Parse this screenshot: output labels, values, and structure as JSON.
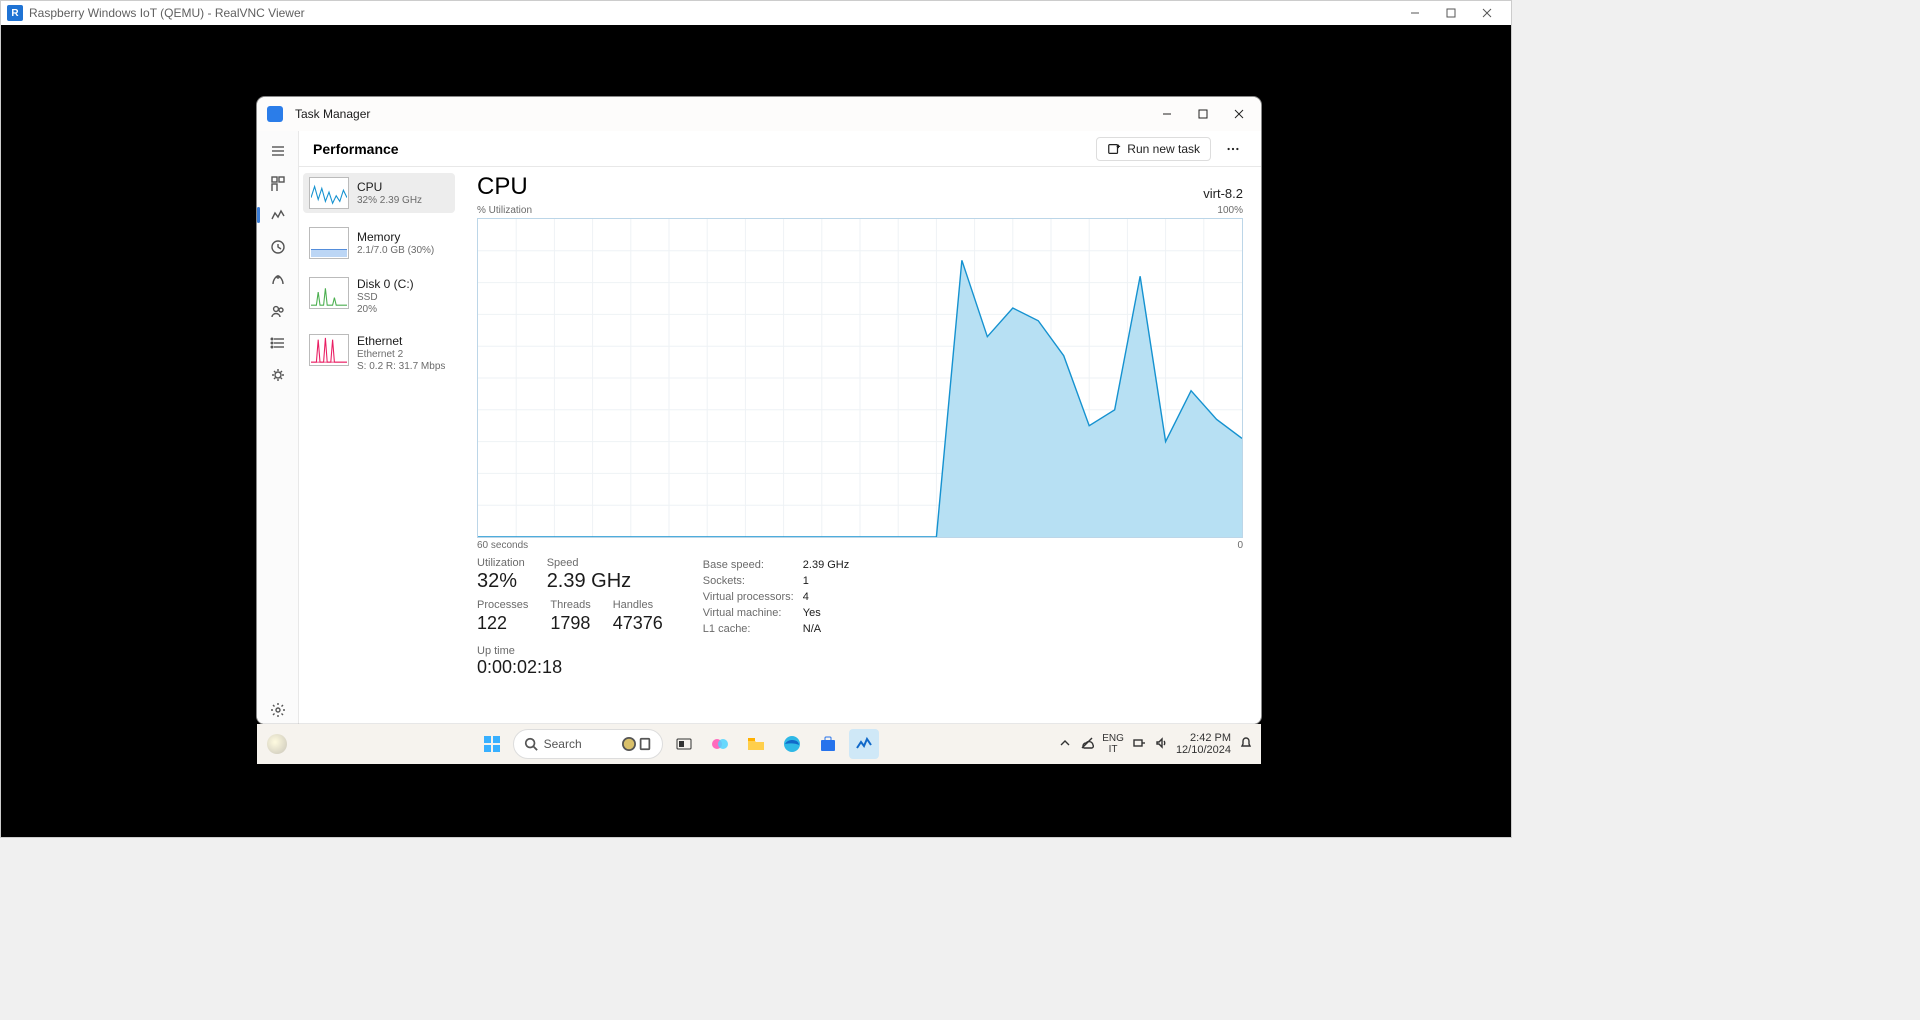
{
  "outer": {
    "title": "Raspberry Windows IoT (QEMU) - RealVNC Viewer"
  },
  "app": {
    "title": "Task Manager",
    "section": "Performance",
    "run_new_task": "Run new task"
  },
  "sidebar": {
    "items": [
      {
        "title": "CPU",
        "sub1": "32%  2.39 GHz"
      },
      {
        "title": "Memory",
        "sub1": "2.1/7.0 GB (30%)"
      },
      {
        "title": "Disk 0 (C:)",
        "sub1": "SSD",
        "sub2": "20%"
      },
      {
        "title": "Ethernet",
        "sub1": "Ethernet 2",
        "sub2": "S: 0.2 R: 31.7 Mbps"
      }
    ]
  },
  "cpu": {
    "name": "CPU",
    "model": "virt-8.2",
    "ylabel": "% Utilization",
    "ymax": "100%",
    "xlabel_left": "60 seconds",
    "xlabel_right": "0",
    "stats": {
      "utilization_label": "Utilization",
      "utilization_value": "32%",
      "speed_label": "Speed",
      "speed_value": "2.39 GHz",
      "processes_label": "Processes",
      "processes_value": "122",
      "threads_label": "Threads",
      "threads_value": "1798",
      "handles_label": "Handles",
      "handles_value": "47376",
      "uptime_label": "Up time",
      "uptime_value": "0:00:02:18"
    },
    "properties": [
      {
        "k": "Base speed:",
        "v": "2.39 GHz"
      },
      {
        "k": "Sockets:",
        "v": "1"
      },
      {
        "k": "Virtual processors:",
        "v": "4"
      },
      {
        "k": "Virtual machine:",
        "v": "Yes"
      },
      {
        "k": "L1 cache:",
        "v": "N/A"
      }
    ]
  },
  "taskbar": {
    "search_placeholder": "Search",
    "lang1": "ENG",
    "lang2": "IT",
    "time": "2:42 PM",
    "date": "12/10/2024"
  },
  "chart_data": {
    "type": "area",
    "xlabel": "seconds ago",
    "ylabel": "% Utilization",
    "ylim": [
      0,
      100
    ],
    "x": [
      60,
      58,
      56,
      54,
      52,
      50,
      48,
      46,
      44,
      42,
      40,
      38,
      36,
      34,
      32,
      30,
      28,
      26,
      24,
      22,
      20,
      18,
      16,
      14,
      12,
      10,
      8,
      6,
      4,
      2,
      0
    ],
    "values": [
      0,
      0,
      0,
      0,
      0,
      0,
      0,
      0,
      0,
      0,
      0,
      0,
      0,
      0,
      0,
      0,
      0,
      0,
      0,
      87,
      63,
      72,
      68,
      57,
      35,
      40,
      82,
      30,
      46,
      37,
      31
    ]
  }
}
